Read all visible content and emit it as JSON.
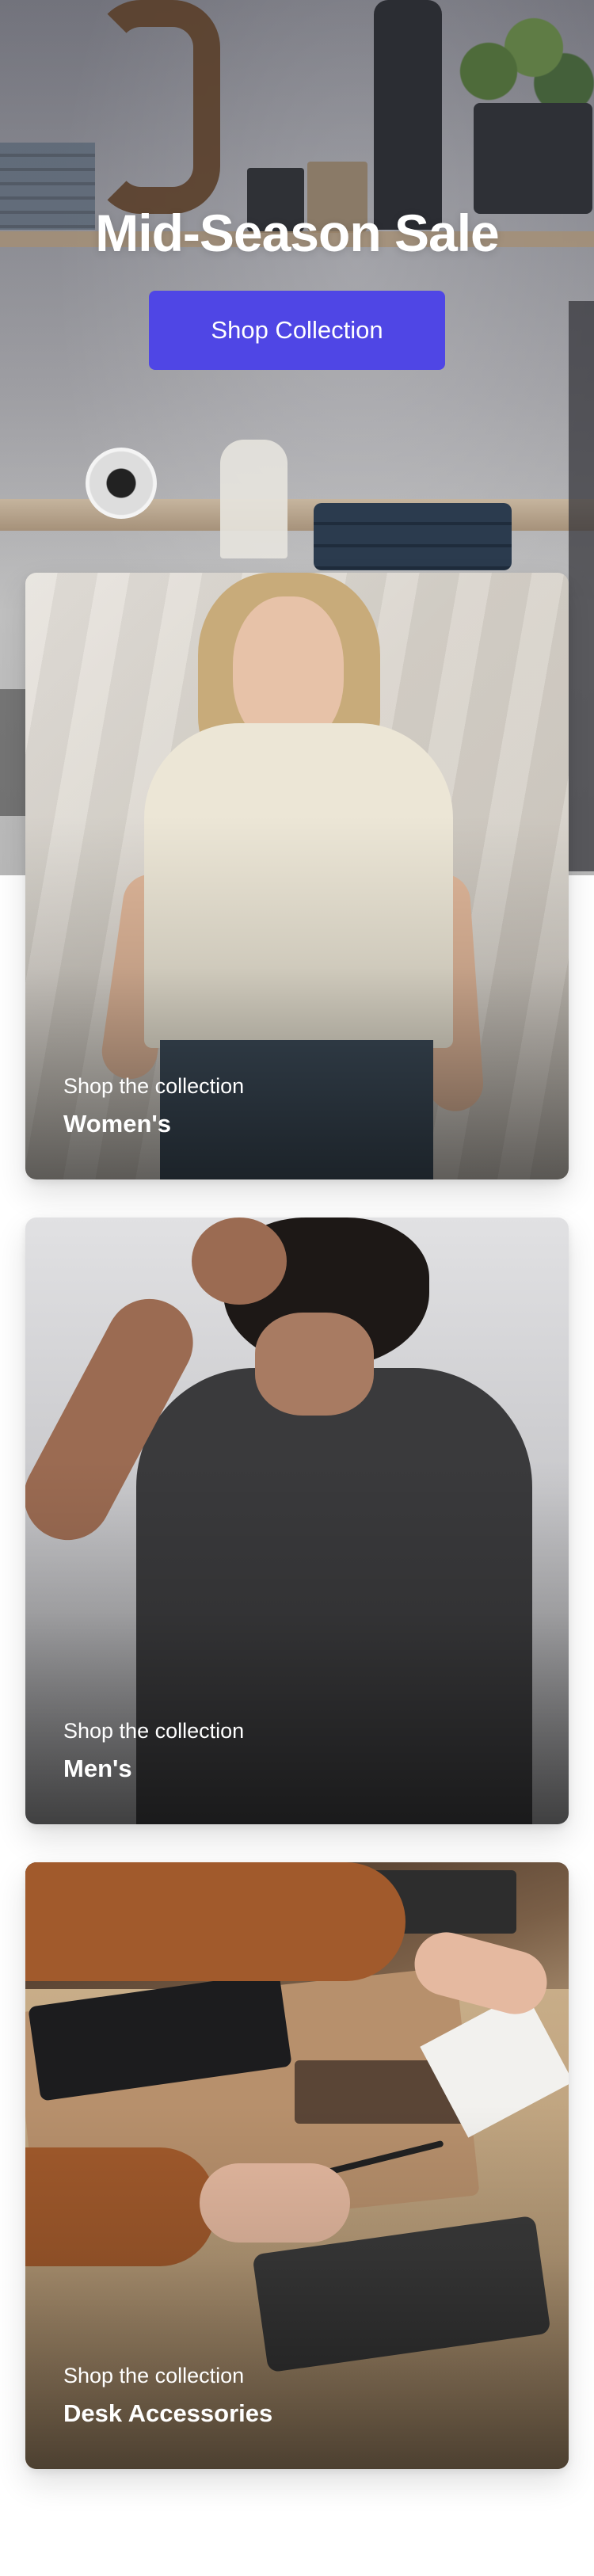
{
  "hero": {
    "title": "Mid-Season Sale",
    "button_label": "Shop Collection",
    "button_color": "#4f46e5"
  },
  "collections": [
    {
      "subtitle": "Shop the collection",
      "title": "Women's"
    },
    {
      "subtitle": "Shop the collection",
      "title": "Men's"
    },
    {
      "subtitle": "Shop the collection",
      "title": "Desk Accessories"
    }
  ]
}
